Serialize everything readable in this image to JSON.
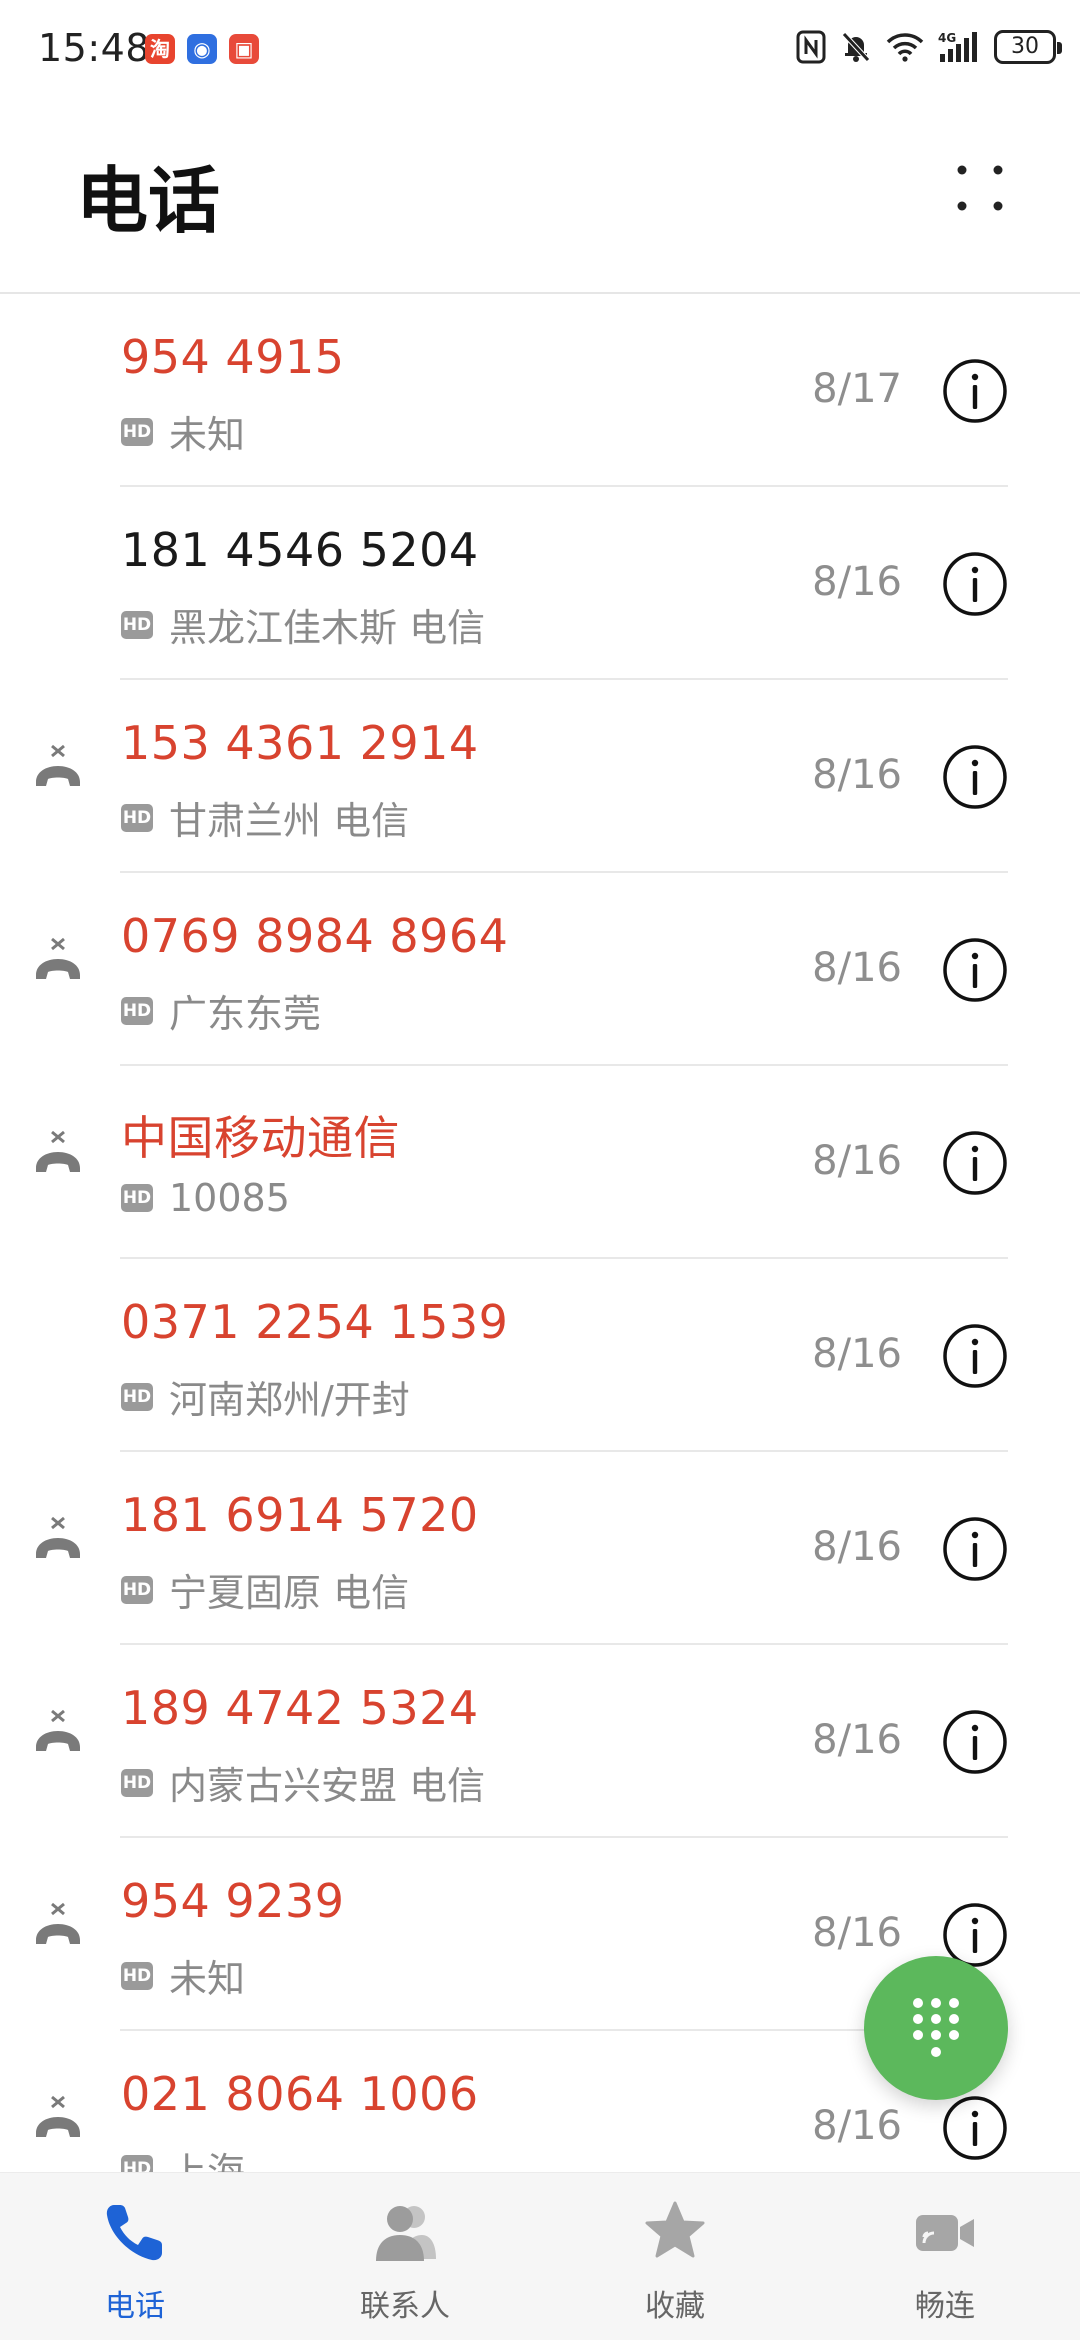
{
  "status_bar": {
    "time": "15:48",
    "apps": [
      {
        "glyph": "淘",
        "color": "#e8442e"
      },
      {
        "glyph": "◉",
        "color": "#2f6fe0"
      },
      {
        "glyph": "▣",
        "color": "#e84a3a"
      }
    ],
    "battery": "30",
    "icons": [
      "nfc-icon",
      "bell-off-icon",
      "wifi-icon",
      "4g-signal-icon"
    ]
  },
  "header": {
    "title": "电话"
  },
  "calls": [
    {
      "name": "954 4915",
      "hd": "HD",
      "location": "未知",
      "date": "8/17",
      "missed": true,
      "show_missed_icon": false
    },
    {
      "name": "181 4546 5204",
      "hd": "HD",
      "location": "黑龙江佳木斯 电信",
      "date": "8/16",
      "missed": false,
      "show_missed_icon": false
    },
    {
      "name": "153 4361 2914",
      "hd": "HD",
      "location": "甘肃兰州 电信",
      "date": "8/16",
      "missed": true,
      "show_missed_icon": true
    },
    {
      "name": "0769 8984 8964",
      "hd": "HD",
      "location": "广东东莞",
      "date": "8/16",
      "missed": true,
      "show_missed_icon": true
    },
    {
      "name": "中国移动通信",
      "hd": "HD",
      "location": "10085",
      "date": "8/16",
      "missed": true,
      "show_missed_icon": true
    },
    {
      "name": "0371 2254 1539",
      "hd": "HD",
      "location": "河南郑州/开封",
      "date": "8/16",
      "missed": true,
      "show_missed_icon": false
    },
    {
      "name": "181 6914 5720",
      "hd": "HD",
      "location": "宁夏固原 电信",
      "date": "8/16",
      "missed": true,
      "show_missed_icon": true
    },
    {
      "name": "189 4742 5324",
      "hd": "HD",
      "location": "内蒙古兴安盟 电信",
      "date": "8/16",
      "missed": true,
      "show_missed_icon": true
    },
    {
      "name": "954 9239",
      "hd": "HD",
      "location": "未知",
      "date": "8/16",
      "missed": true,
      "show_missed_icon": true
    },
    {
      "name": "021 8064 1006",
      "hd": "HD",
      "location": "上海",
      "date": "8/16",
      "missed": true,
      "show_missed_icon": true
    }
  ],
  "colors": {
    "missed": "#d8432f",
    "accent": "#1e63d6",
    "fab": "#5cb85c"
  },
  "bottom_nav": [
    {
      "label": "电话",
      "icon": "phone-icon",
      "active": true
    },
    {
      "label": "联系人",
      "icon": "contacts-icon",
      "active": false
    },
    {
      "label": "收藏",
      "icon": "star-icon",
      "active": false
    },
    {
      "label": "畅连",
      "icon": "video-call-icon",
      "active": false
    }
  ]
}
